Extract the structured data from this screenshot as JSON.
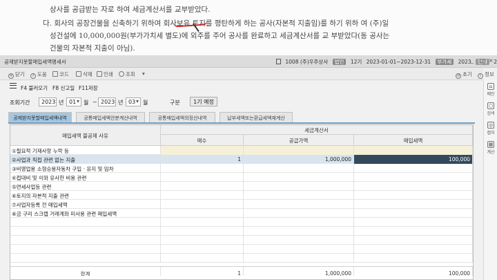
{
  "document": {
    "line1": "상사를 공급받는 자로 하여 세금계산서를 교부받았다.",
    "line2": "다. 회사의 공장건물을 신축하기 위하여 회사보유 토지를 평탄하게 하는 공사(자본적 지출임)를 하기 위하 여 (주)일",
    "line3": "성건설에 10,000,000원(부가가치세 별도)에 외주를 주어 공사를 완료하고 세금계산서를 교 부받았다(동 공사는",
    "line4": "건물의 자본적 지출이 아님)."
  },
  "titlebar": {
    "title": "공제받지못할매입세액명세서",
    "company": "1008 (주)우주상사",
    "badge1": "법인",
    "term": "12기",
    "period": "2023-01-01~2023-12-31",
    "badge2": "부가세",
    "year": "2023",
    "badge3": "인사",
    "year2": "2023"
  },
  "toolbar": {
    "close": "닫기",
    "help": "도움",
    "code": "코드",
    "delete": "삭제",
    "print": "인쇄",
    "search": "조회",
    "reset": "초기",
    "info": "정보"
  },
  "fnbar": {
    "f4": "F4 불러오기",
    "f8": "F8 신고일",
    "f11": "F11저장"
  },
  "period": {
    "label": "조회기간",
    "from_year": "2023",
    "year_suffix": "년",
    "from_month": "01",
    "month_suffix": "월",
    "tilde": "~",
    "to_year": "2023",
    "year_suffix2": "년",
    "to_month": "03",
    "month_suffix2": "월",
    "gubun_label": "구분",
    "gubun_value": "1기 예정"
  },
  "tabs": [
    "공제받지못할매입세액내역",
    "공통매입세액안분계산내역",
    "공통매입세액의정산내역",
    "납부세액또는환급세액재계산"
  ],
  "table": {
    "header_reason": "매입세액 불공제 사유",
    "header_group": "세금계산서",
    "header_count": "매수",
    "header_supply": "공급가액",
    "header_tax": "매입세액",
    "rows": [
      {
        "reason": "①필요적 기재사항 누락 등",
        "count": "",
        "supply": "",
        "tax": ""
      },
      {
        "reason": "②사업과 직접 관련 없는 지출",
        "count": "1",
        "supply": "1,000,000",
        "tax": "100,000"
      },
      {
        "reason": "③비영업용 소형승용자동차 구입 · 유지 및 임차",
        "count": "",
        "supply": "",
        "tax": ""
      },
      {
        "reason": "④접대비 및 이와 유사한 비용 관련",
        "count": "",
        "supply": "",
        "tax": ""
      },
      {
        "reason": "⑤면세사업등 관련",
        "count": "",
        "supply": "",
        "tax": ""
      },
      {
        "reason": "⑥토지의 자본적 지출 관련",
        "count": "",
        "supply": "",
        "tax": ""
      },
      {
        "reason": "⑦사업자등록 전 매입세액",
        "count": "",
        "supply": "",
        "tax": ""
      },
      {
        "reason": "⑧금  구리 스크랩 거래계좌 미사용 관련 매입세액",
        "count": "",
        "supply": "",
        "tax": ""
      }
    ],
    "total_label": "합계",
    "total_count": "1",
    "total_supply": "1,000,000",
    "total_tax": "100,000"
  },
  "sidepanel": {
    "home": "메인",
    "search": "검색",
    "scan": "캡처",
    "calc": "계산"
  }
}
